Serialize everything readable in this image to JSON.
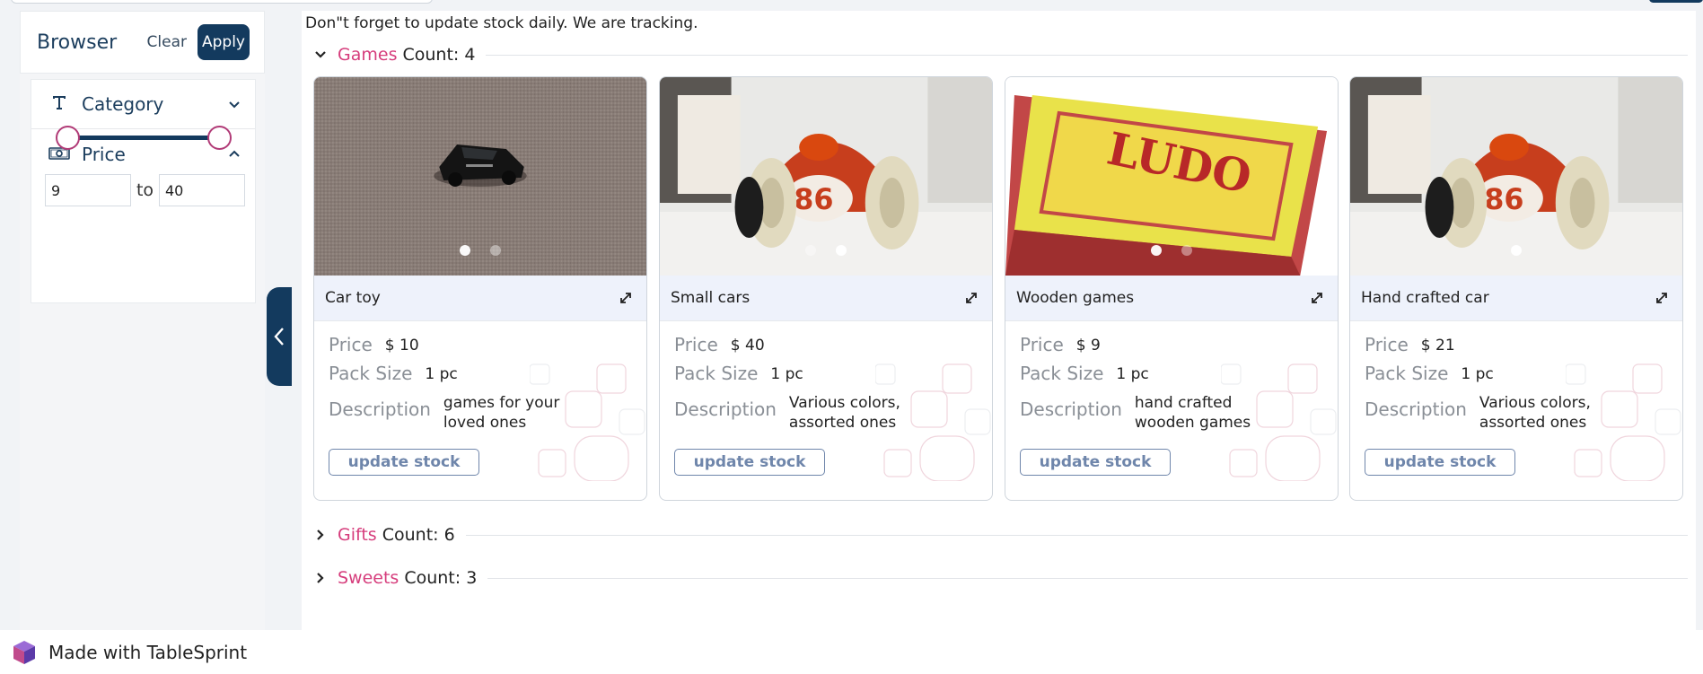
{
  "notice": "Don\"t forget to update stock daily. We are tracking.",
  "sidebar": {
    "title": "Browser",
    "clear_label": "Clear",
    "apply_label": "Apply",
    "filters": [
      {
        "label": "Category",
        "icon": "text-t-icon",
        "expanded": false
      },
      {
        "label": "Price",
        "icon": "banknote-icon",
        "expanded": true
      }
    ],
    "price_range": {
      "min": "9",
      "max": "40",
      "to_label": "to"
    }
  },
  "groups": [
    {
      "name": "Games",
      "count_label": "Count: 4",
      "expanded": true
    },
    {
      "name": "Gifts",
      "count_label": "Count: 6",
      "expanded": false
    },
    {
      "name": "Sweets",
      "count_label": "Count: 3",
      "expanded": false
    }
  ],
  "labels": {
    "price": "Price",
    "pack_size": "Pack Size",
    "description": "Description",
    "update_stock": "update stock"
  },
  "cards": [
    {
      "title": "Car toy",
      "price": "$ 10",
      "pack_size": "1 pc",
      "description": "games for your loved ones"
    },
    {
      "title": "Small cars",
      "price": "$ 40",
      "pack_size": "1 pc",
      "description": "Various colors, assorted ones"
    },
    {
      "title": "Wooden games",
      "price": "$ 9",
      "pack_size": "1 pc",
      "description": "hand crafted wooden games"
    },
    {
      "title": "Hand crafted car",
      "price": "$ 21",
      "pack_size": "1 pc",
      "description": "Various colors, assorted ones"
    }
  ],
  "footer": {
    "text": "Made with TableSprint"
  },
  "colors": {
    "brand_navy": "#133a5e",
    "group_pink": "#d63d7c",
    "slider_thumb": "#b13b77"
  }
}
